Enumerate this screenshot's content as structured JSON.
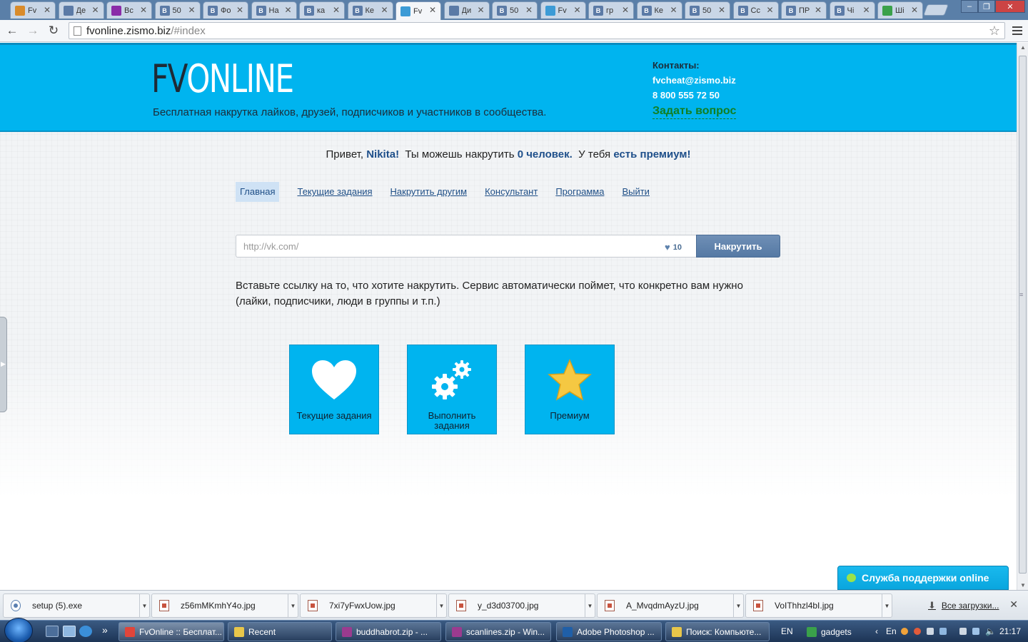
{
  "browser": {
    "tabs": [
      {
        "label": "Fv",
        "fav": "",
        "color": "#d98b2b"
      },
      {
        "label": "Де",
        "fav": "",
        "color": "#5b7aa6"
      },
      {
        "label": "Вс",
        "fav": "",
        "color": "#8a2ca8"
      },
      {
        "label": "50",
        "fav": "B",
        "color": "#5b7aa6"
      },
      {
        "label": "Фо",
        "fav": "B",
        "color": "#5b7aa6"
      },
      {
        "label": "На",
        "fav": "B",
        "color": "#5b7aa6"
      },
      {
        "label": "ка",
        "fav": "B",
        "color": "#5b7aa6"
      },
      {
        "label": "Ке",
        "fav": "B",
        "color": "#5b7aa6"
      },
      {
        "label": "Fv",
        "fav": "",
        "color": "#3c9bd6"
      },
      {
        "label": "Ди",
        "fav": "",
        "color": "#5b7aa6"
      },
      {
        "label": "50",
        "fav": "B",
        "color": "#5b7aa6"
      },
      {
        "label": "Fv",
        "fav": "",
        "color": "#3c9bd6"
      },
      {
        "label": "гр",
        "fav": "B",
        "color": "#5b7aa6"
      },
      {
        "label": "Ке",
        "fav": "B",
        "color": "#5b7aa6"
      },
      {
        "label": "50",
        "fav": "B",
        "color": "#5b7aa6"
      },
      {
        "label": "Сс",
        "fav": "B",
        "color": "#5b7aa6"
      },
      {
        "label": "ПР",
        "fav": "B",
        "color": "#5b7aa6"
      },
      {
        "label": "Чі",
        "fav": "B",
        "color": "#5b7aa6"
      },
      {
        "label": "Ші",
        "fav": "",
        "color": "#3aa14a"
      }
    ],
    "active_tab_index": 8,
    "address": {
      "host": "fvonline.zismo.biz",
      "path": "/#index"
    },
    "nav_icons": {
      "back": "back-arrow-icon",
      "forward": "forward-arrow-icon",
      "reload": "reload-icon",
      "bookmark": "star-icon",
      "menu": "menu-icon"
    }
  },
  "site": {
    "logo_dark": "FV",
    "logo_light": "ONLINE",
    "tagline": "Бесплатная накрутка лайков, друзей, подписчиков и участников в сообщества.",
    "contacts_label": "Контакты:",
    "email": "fvcheat@zismo.biz",
    "phone": "8 800 555 72 50",
    "ask_link": "Задать вопрос",
    "colors": {
      "header": "#00b4ef",
      "link": "#1f4f87",
      "ask": "#117f22"
    }
  },
  "greeting": {
    "hello": "Привет,",
    "name": "Nikita!",
    "can_boost": "Ты можешь накрутить",
    "count": "0 человек.",
    "you_have": "У тебя",
    "premium": "есть премиум!"
  },
  "nav": [
    {
      "label": "Главная",
      "active": true
    },
    {
      "label": "Текущие задания"
    },
    {
      "label": "Накрутить другим"
    },
    {
      "label": "Консультант"
    },
    {
      "label": "Программа"
    },
    {
      "label": "Выйти"
    }
  ],
  "form": {
    "placeholder": "http://vk.com/",
    "likes": "10",
    "submit": "Накрутить"
  },
  "hint": "Вставьте ссылку на то, что хотите накрутить. Сервис автоматически поймет, что конкретно вам нужно (лайки, подписчики, люди в группы и т.п.)",
  "tiles": [
    {
      "label": "Текущие задания",
      "icon": "heart-icon"
    },
    {
      "label": "Выполнить задания",
      "icon": "gears-icon"
    },
    {
      "label": "Премиум",
      "icon": "star-icon"
    }
  ],
  "support": "Служба поддержки online",
  "downloads": {
    "items": [
      {
        "name": "setup (5).exe",
        "type": "exe"
      },
      {
        "name": "z56mMKmhY4o.jpg",
        "type": "jpg"
      },
      {
        "name": "7xi7yFwxUow.jpg",
        "type": "jpg"
      },
      {
        "name": "y_d3d03700.jpg",
        "type": "jpg"
      },
      {
        "name": "A_MvqdmAyzU.jpg",
        "type": "jpg"
      },
      {
        "name": "VoIThhzl4bI.jpg",
        "type": "jpg"
      }
    ],
    "all": "Все загрузки..."
  },
  "taskbar": {
    "tasks": [
      {
        "label": "FvOnline :: Бесплат...",
        "color": "#e0453a",
        "active": true
      },
      {
        "label": "Recent",
        "color": "#e8c64a"
      },
      {
        "label": "buddhabrot.zip - ...",
        "color": "#9b3b8f"
      },
      {
        "label": "scanlines.zip - Win...",
        "color": "#9b3b8f"
      },
      {
        "label": "Adobe Photoshop ...",
        "color": "#1f5fa8"
      },
      {
        "label": "Поиск: Компьюте...",
        "color": "#e8c64a"
      },
      {
        "label": "gadgets",
        "color": "#3aa14a"
      }
    ],
    "lang": "EN",
    "tray_lang": "En",
    "clock": "21:17"
  }
}
